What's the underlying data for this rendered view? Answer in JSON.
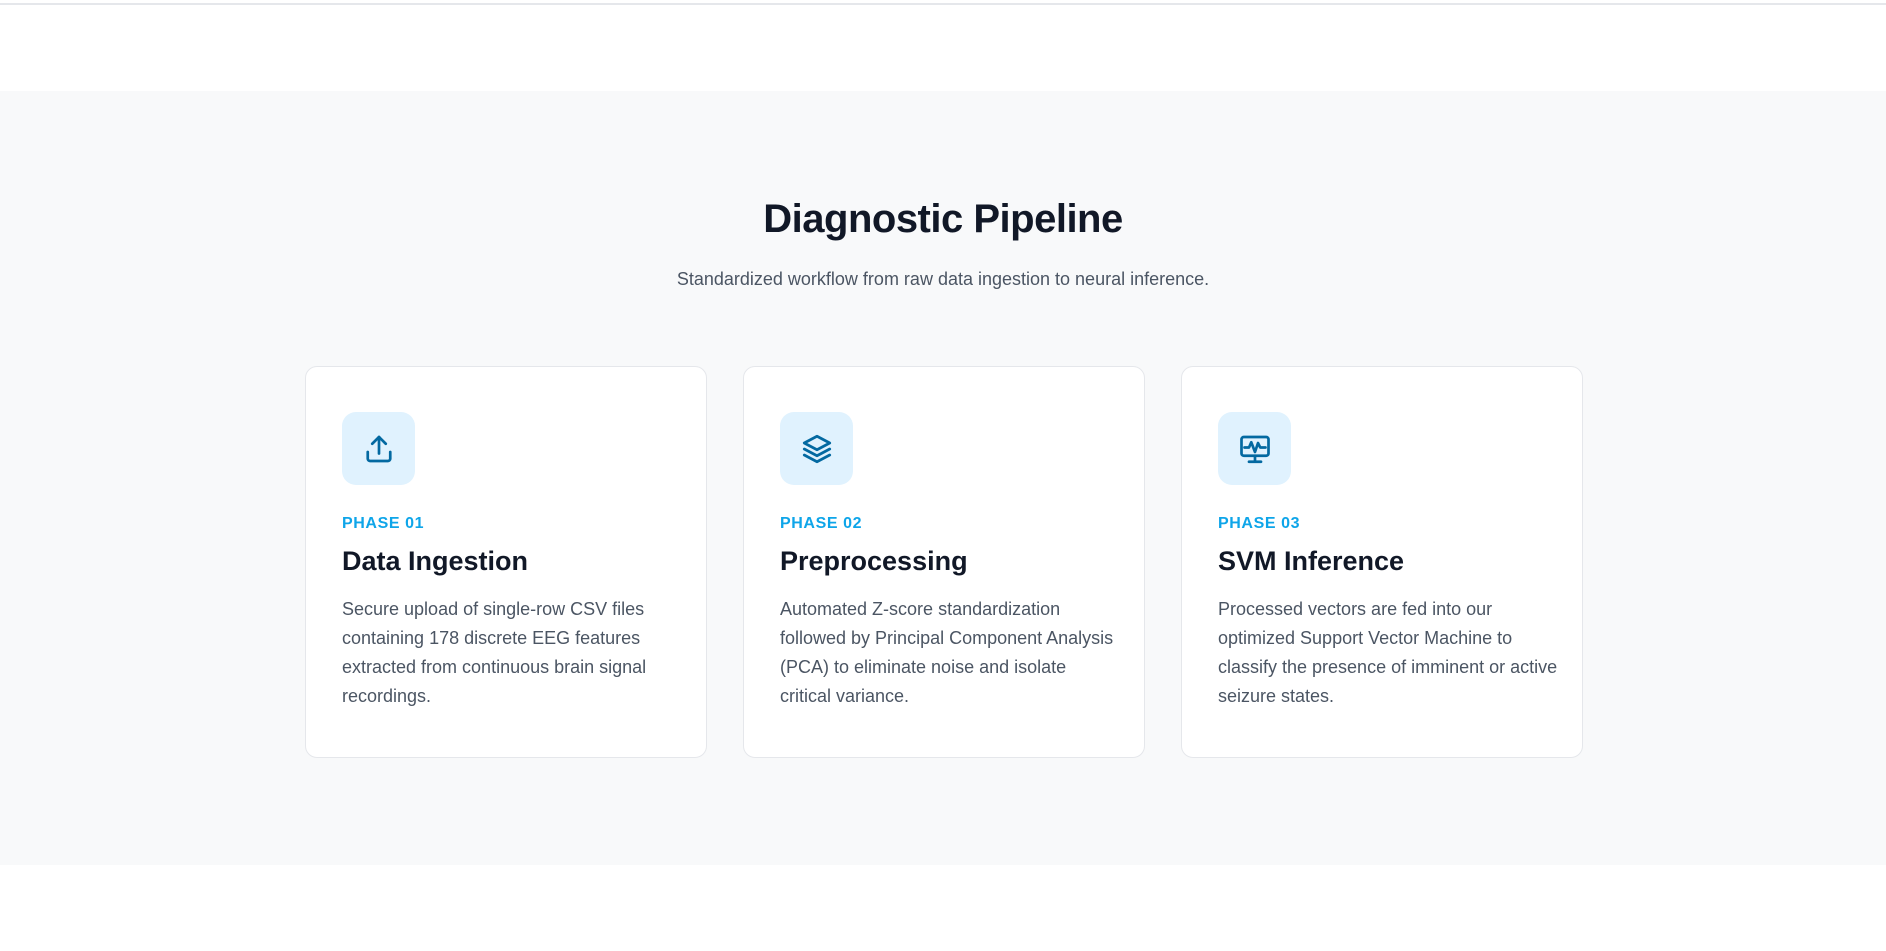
{
  "section": {
    "title": "Diagnostic Pipeline",
    "subtitle": "Standardized workflow from raw data ingestion to neural inference."
  },
  "cards": [
    {
      "icon": "upload-icon",
      "phase": "PHASE 01",
      "title": "Data Ingestion",
      "description": "Secure upload of single-row CSV files containing 178 discrete EEG features extracted from continuous brain signal recordings."
    },
    {
      "icon": "layers-icon",
      "phase": "PHASE 02",
      "title": "Preprocessing",
      "description": "Automated Z-score standardization followed by Principal Component Analysis (PCA) to eliminate noise and isolate critical variance."
    },
    {
      "icon": "monitor-waveform-icon",
      "phase": "PHASE 03",
      "title": "SVM Inference",
      "description": "Processed vectors are fed into our optimized Support Vector Machine to classify the presence of imminent or active seizure states."
    }
  ],
  "colors": {
    "accent": "#0ea5e9",
    "icon_stroke": "#0369a1",
    "icon_bg": "#e0f2fe",
    "section_bg": "#f8f9fa",
    "card_border": "#e5e7eb"
  }
}
